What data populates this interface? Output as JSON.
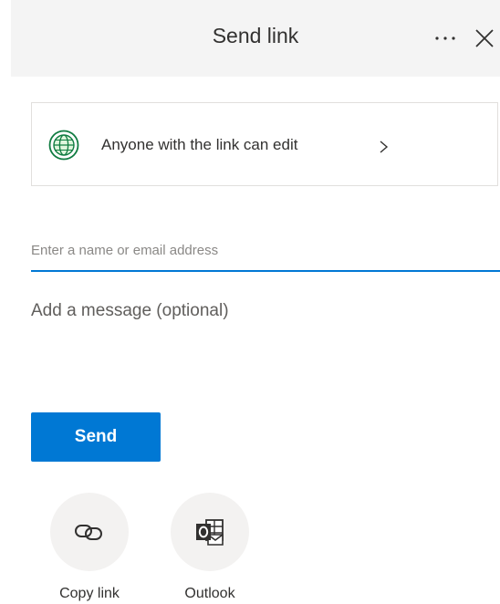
{
  "dialog": {
    "title": "Send link",
    "more_icon": "more-icon",
    "close_icon": "close-icon"
  },
  "permission": {
    "icon": "globe-icon",
    "text": "Anyone with the link can edit",
    "chevron_icon": "chevron-right-icon"
  },
  "recipient": {
    "value": "",
    "placeholder": "Enter a name or email address"
  },
  "message": {
    "value": "",
    "placeholder": "Add a message (optional)"
  },
  "send_label": "Send",
  "share_options": [
    {
      "label": "Copy link",
      "icon": "link-icon"
    },
    {
      "label": "Outlook",
      "icon": "outlook-icon"
    }
  ],
  "colors": {
    "accent": "#0078d4",
    "header_bg": "#f4f4f4",
    "globe": "#107c41",
    "option_bg": "#f3f2f1"
  }
}
